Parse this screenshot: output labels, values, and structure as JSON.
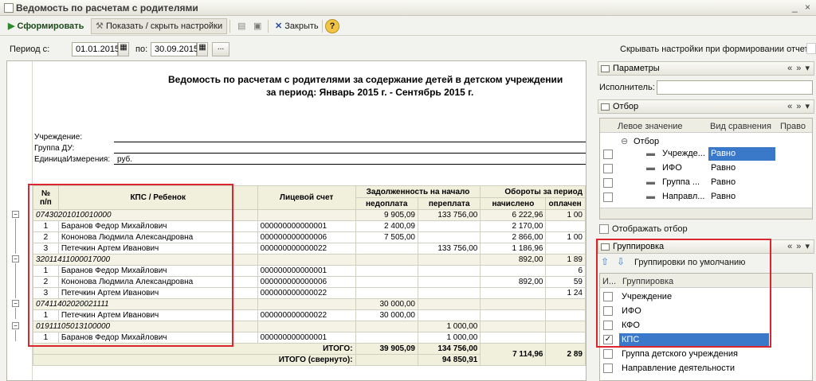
{
  "window": {
    "title": "Ведомость по расчетам с родителями"
  },
  "toolbar": {
    "generate": "Сформировать",
    "toggle_settings": "Показать / скрыть настройки",
    "close": "Закрыть",
    "help": "?"
  },
  "period": {
    "label_from": "Период с:",
    "date_from": "01.01.2015",
    "label_to": "по:",
    "date_to": "30.09.2015",
    "ellipsis": "..."
  },
  "hide_settings_label": "Скрывать настройки при формировании отчета",
  "report": {
    "title1": "Ведомость по расчетам с родителями за содержание детей в детском учреждении",
    "title2": "за период: Январь 2015 г. - Сентябрь 2015 г.",
    "institution_label": "Учреждение:",
    "group_label": "Группа ДУ:",
    "unit_label": "ЕдиницаИзмерения:",
    "unit_value": "руб.",
    "headers": {
      "num": "№\nп/п",
      "kps": "КПС / Ребенок",
      "account": "Лицевой счет",
      "debt": "Задолженность на начало",
      "underpay": "недоплата",
      "overpay": "переплата",
      "turnover": "Обороты за период",
      "accrued": "начислено",
      "paid": "оплачен"
    },
    "rows": [
      {
        "type": "group",
        "kps": "07430201010010000",
        "account": "",
        "under": "9 905,09",
        "over": "133 756,00",
        "acc": "6 222,96",
        "paid": "1 00"
      },
      {
        "type": "item",
        "n": "1",
        "kps": "Баранов Федор Михайлович",
        "account": "000000000000001",
        "under": "2 400,09",
        "over": "",
        "acc": "2 170,00",
        "paid": ""
      },
      {
        "type": "item",
        "n": "2",
        "kps": "Кононова Людмила Александровна",
        "account": "000000000000006",
        "under": "7 505,00",
        "over": "",
        "acc": "2 866,00",
        "paid": "1 00"
      },
      {
        "type": "item",
        "n": "3",
        "kps": "Петечкин Артем Иванович",
        "account": "000000000000022",
        "under": "",
        "over": "133 756,00",
        "acc": "1 186,96",
        "paid": ""
      },
      {
        "type": "group",
        "kps": "32011411000017000",
        "account": "",
        "under": "",
        "over": "",
        "acc": "892,00",
        "paid": "1 89"
      },
      {
        "type": "item",
        "n": "1",
        "kps": "Баранов Федор Михайлович",
        "account": "000000000000001",
        "under": "",
        "over": "",
        "acc": "",
        "paid": "6"
      },
      {
        "type": "item",
        "n": "2",
        "kps": "Кононова Людмила Александровна",
        "account": "000000000000006",
        "under": "",
        "over": "",
        "acc": "892,00",
        "paid": "59"
      },
      {
        "type": "item",
        "n": "3",
        "kps": "Петечкин Артем Иванович",
        "account": "000000000000022",
        "under": "",
        "over": "",
        "acc": "",
        "paid": "1 24"
      },
      {
        "type": "group",
        "kps": "07411402020021111",
        "account": "",
        "under": "30 000,00",
        "over": "",
        "acc": "",
        "paid": ""
      },
      {
        "type": "item",
        "n": "1",
        "kps": "Петечкин Артем Иванович",
        "account": "000000000000022",
        "under": "30 000,00",
        "over": "",
        "acc": "",
        "paid": ""
      },
      {
        "type": "group",
        "kps": "01911105013100000",
        "account": "",
        "under": "",
        "over": "1 000,00",
        "acc": "",
        "paid": ""
      },
      {
        "type": "item",
        "n": "1",
        "kps": "Баранов Федор Михайлович",
        "account": "000000000000001",
        "under": "",
        "over": "1 000,00",
        "acc": "",
        "paid": ""
      }
    ],
    "total_label": "ИТОГО:",
    "total_under": "39 905,09",
    "total_over": "134 756,00",
    "total_acc": "7 114,96",
    "total_paid": "2 89",
    "total_coll_label": "ИТОГО (свернуто):",
    "total_coll_over": "94 850,91"
  },
  "params": {
    "title": "Параметры",
    "executor_label": "Исполнитель:",
    "nav": "« » ▾"
  },
  "filter": {
    "title": "Отбор",
    "col_left": "Левое значение",
    "col_cmp": "Вид сравнения",
    "col_right": "Право",
    "root": "Отбор",
    "items": [
      {
        "name": "Учрежде...",
        "cmp": "Равно"
      },
      {
        "name": "ИФО",
        "cmp": "Равно"
      },
      {
        "name": "Группа ...",
        "cmp": "Равно"
      },
      {
        "name": "Направл...",
        "cmp": "Равно"
      }
    ],
    "show_filter": "Отображать отбор"
  },
  "grouping": {
    "title": "Группировка",
    "default_label": "Группировки по умолчанию",
    "col_i": "И...",
    "col_name": "Группировка",
    "items": [
      {
        "name": "Учреждение",
        "checked": false,
        "selected": false
      },
      {
        "name": "ИФО",
        "checked": false,
        "selected": false
      },
      {
        "name": "КФО",
        "checked": false,
        "selected": false
      },
      {
        "name": "КПС",
        "checked": true,
        "selected": true
      },
      {
        "name": "Группа детского учреждения",
        "checked": false,
        "selected": false
      },
      {
        "name": "Направление деятельности",
        "checked": false,
        "selected": false
      }
    ]
  },
  "colors": {
    "highlight_box": "#d9262f",
    "selection": "#3a78c9"
  }
}
